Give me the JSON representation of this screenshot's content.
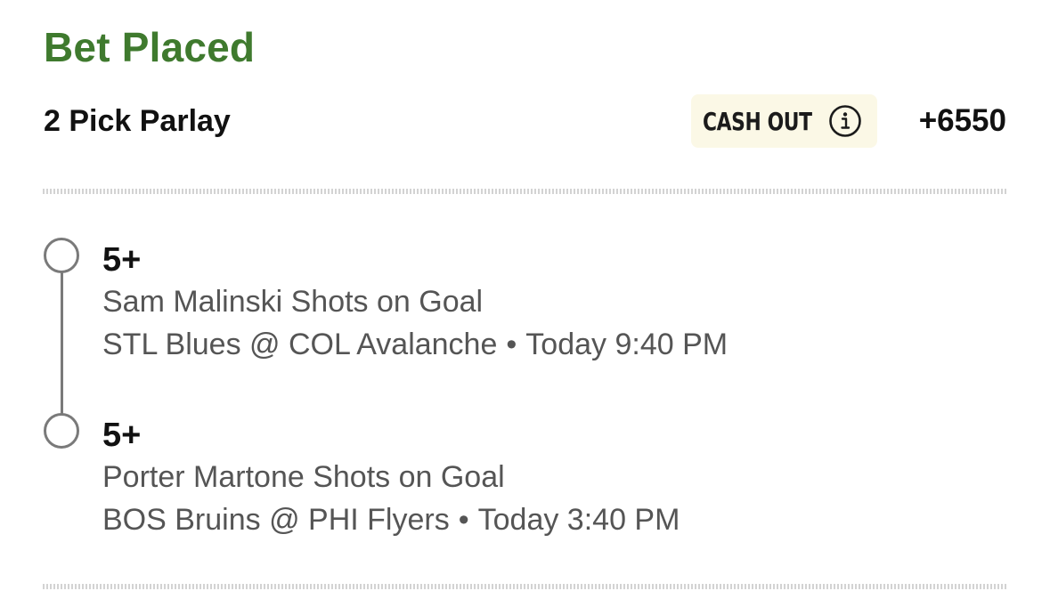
{
  "header": {
    "title": "Bet Placed",
    "title_color": "#3f7a2e"
  },
  "bet": {
    "type_label": "2 Pick Parlay",
    "cash_out_label": "CASH OUT",
    "cash_out_icon": "info-icon",
    "odds": "+6550"
  },
  "legs": [
    {
      "line": "5+",
      "market": "Sam Malinski Shots on Goal",
      "matchup": "STL Blues @ COL Avalanche",
      "separator": "•",
      "time": "Today 9:40 PM"
    },
    {
      "line": "5+",
      "market": "Porter Martone Shots on Goal",
      "matchup": "BOS Bruins @ PHI Flyers",
      "separator": "•",
      "time": "Today 3:40 PM"
    }
  ]
}
